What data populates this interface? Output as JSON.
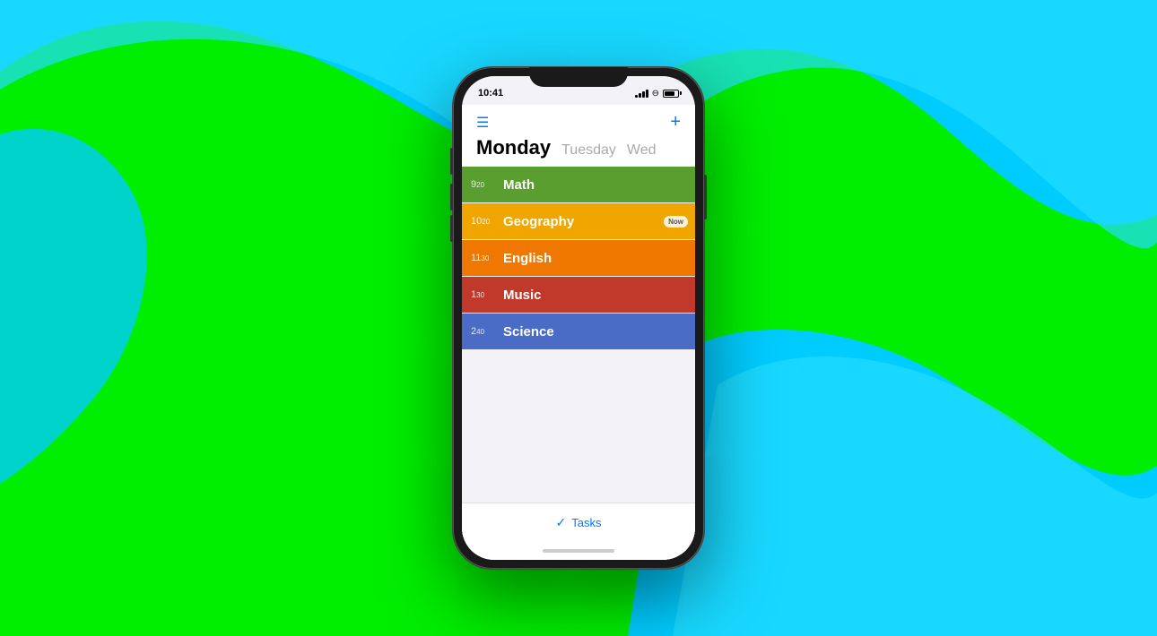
{
  "background": {
    "color_green": "#00ee00",
    "color_cyan": "#00ddff"
  },
  "phone": {
    "status_bar": {
      "time": "10:41",
      "signal_label": "signal",
      "wifi_label": "wifi",
      "battery_label": "battery"
    },
    "toolbar": {
      "menu_label": "☰",
      "add_label": "+"
    },
    "day_tabs": {
      "monday": "Monday",
      "tuesday": "Tuesday",
      "wednesday": "Wed"
    },
    "schedule": [
      {
        "hour": "9",
        "min": "20",
        "subject": "Math",
        "color_class": "item-math",
        "now": false
      },
      {
        "hour": "10",
        "min": "20",
        "subject": "Geography",
        "color_class": "item-geography",
        "now": true
      },
      {
        "hour": "11",
        "min": "30",
        "subject": "English",
        "color_class": "item-english",
        "now": false
      },
      {
        "hour": "1",
        "min": "30",
        "subject": "Music",
        "color_class": "item-music",
        "now": false
      },
      {
        "hour": "2",
        "min": "40",
        "subject": "Science",
        "color_class": "item-science",
        "now": false
      }
    ],
    "now_badge_label": "Now",
    "bottom_bar": {
      "tasks_label": "Tasks"
    }
  }
}
